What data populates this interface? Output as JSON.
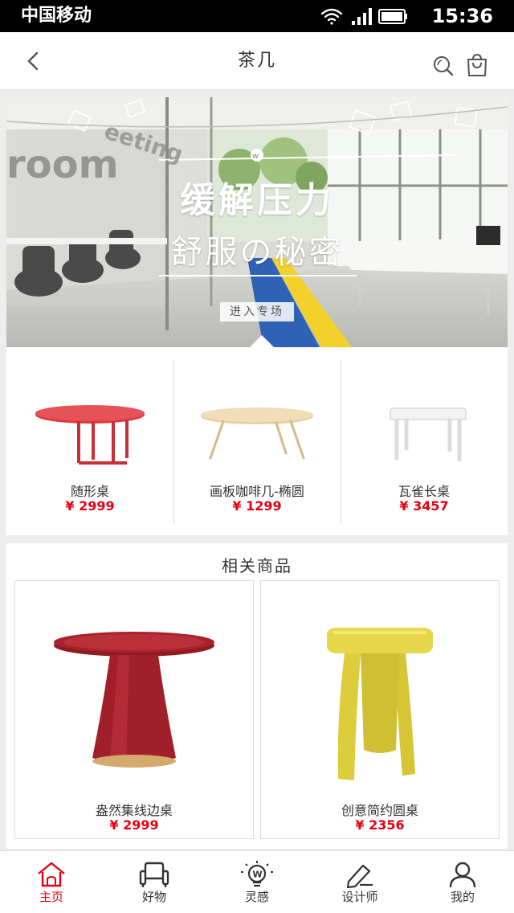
{
  "status_bar": {
    "carrier": "中国移动",
    "time": "15:36"
  },
  "header": {
    "title": "茶几",
    "back_icon": "back-arrow-icon",
    "search_icon": "search-icon",
    "cart_icon": "shopping-bag-icon"
  },
  "banner": {
    "title": "缓解压力",
    "subtitle": "舒服の秘密",
    "button_label": "进入专场",
    "wall_text_1": "room",
    "wall_text_2": "eeting"
  },
  "products": [
    {
      "name": "随形桌",
      "price": "¥ 2999"
    },
    {
      "name": "画板咖啡几-椭圆",
      "price": "¥ 1299"
    },
    {
      "name": "瓦雀长桌",
      "price": "¥ 3457"
    }
  ],
  "related": {
    "title": "相关商品",
    "items": [
      {
        "name": "盎然集线边桌",
        "price": "¥ 2999"
      },
      {
        "name": "创意简约圆桌",
        "price": "¥ 2356"
      }
    ]
  },
  "tabbar": {
    "items": [
      {
        "label": "主页",
        "icon": "home-icon",
        "active": true
      },
      {
        "label": "好物",
        "icon": "armchair-icon",
        "active": false
      },
      {
        "label": "灵感",
        "icon": "lightbulb-icon",
        "active": false
      },
      {
        "label": "设计师",
        "icon": "pencil-icon",
        "active": false
      },
      {
        "label": "我的",
        "icon": "user-icon",
        "active": false
      }
    ]
  },
  "colors": {
    "accent_red": "#e60012",
    "page_bg": "#ededed",
    "text": "#333333"
  }
}
